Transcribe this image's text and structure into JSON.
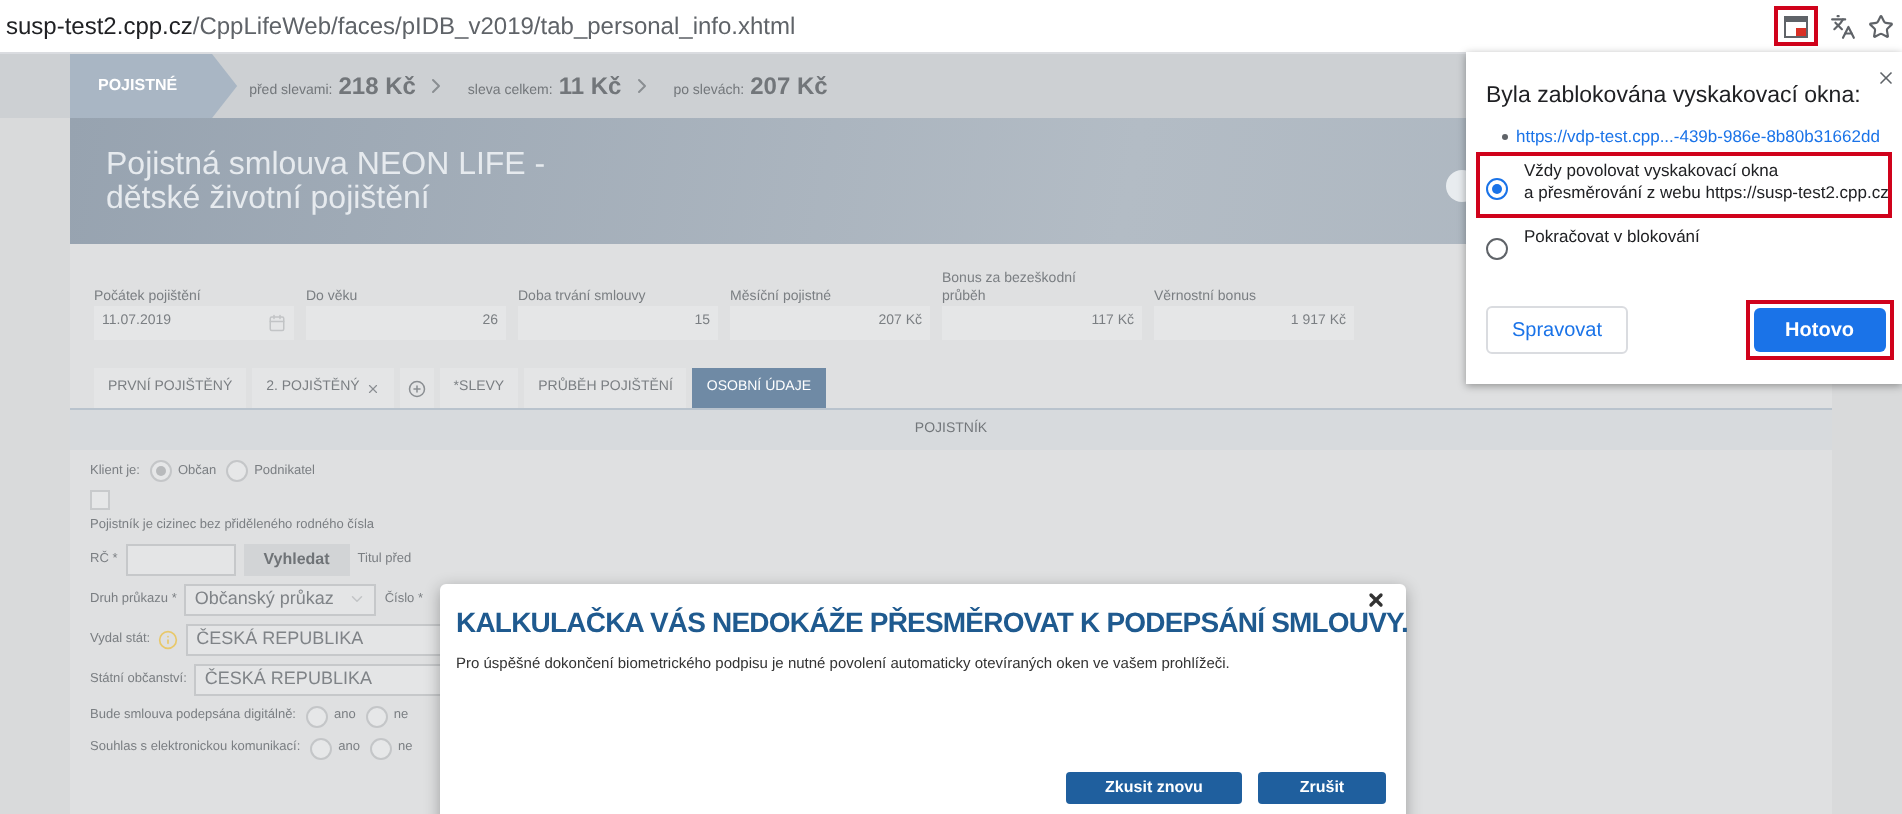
{
  "address_bar": {
    "url_host": "susp-test2.cpp.cz",
    "url_path": "/CppLifeWeb/faces/pIDB_v2019/tab_personal_info.xhtml",
    "popup_blocked_icon_highlighted": true
  },
  "premium_bar": {
    "label": "POJISTNÉ",
    "items": [
      {
        "caption": "před slevami:",
        "amount": "218 Kč"
      },
      {
        "caption": "sleva celkem:",
        "amount": "11 Kč"
      },
      {
        "caption": "po slevách:",
        "amount": "207 Kč"
      }
    ]
  },
  "banner": {
    "title": "Pojistná smlouva NEON LIFE - dětské životní pojištění"
  },
  "summary_fields": [
    {
      "label": "Počátek pojištění",
      "value": "11.07.2019",
      "kind": "date"
    },
    {
      "label": "Do věku",
      "value": "26",
      "kind": "text"
    },
    {
      "label": "Doba trvání smlouvy",
      "value": "15",
      "kind": "text"
    },
    {
      "label": "Měsíční pojistné",
      "value": "207 Kč",
      "kind": "text"
    },
    {
      "label": "Bonus za bezeškodní průběh",
      "value": "117 Kč",
      "kind": "text"
    },
    {
      "label": "Věrnostní bonus",
      "value": "1 917 Kč",
      "kind": "text"
    }
  ],
  "tabs": [
    {
      "kind": "tab",
      "label": "PRVNÍ POJIŠTĚNÝ",
      "selected": false,
      "closable": false
    },
    {
      "kind": "tab",
      "label": "2. POJIŠTĚNÝ",
      "selected": false,
      "closable": true
    },
    {
      "kind": "add",
      "selected": false
    },
    {
      "kind": "tab",
      "label": "*SLEVY",
      "selected": false,
      "closable": false
    },
    {
      "kind": "tab",
      "label": "PRŮBĚH POJIŠTĚNÍ",
      "selected": false,
      "closable": false
    },
    {
      "kind": "tab",
      "label": "OSOBNÍ ÚDAJE",
      "selected": true,
      "closable": false
    }
  ],
  "section": {
    "title": "POJISTNÍK",
    "client_type": {
      "label": "Klient je:",
      "options": [
        {
          "label": "Občan",
          "selected": true
        },
        {
          "label": "Podnikatel",
          "selected": false
        }
      ]
    },
    "foreigner_checkbox": {
      "checked": false,
      "label": "Pojistník je cizinec bez přiděleného rodného čísla"
    },
    "rc": {
      "label": "RČ *",
      "button": "Vyhledat",
      "next_label": "Titul před"
    },
    "id_type": {
      "label": "Druh průkazu *",
      "value": "Občanský průkaz",
      "next_label": "Číslo *"
    },
    "issued_by": {
      "label": "Vydal stát:",
      "value": "ČESKÁ REPUBLIKA"
    },
    "citizenship": {
      "label": "Státní občanství:",
      "value": "ČESKÁ REPUBLIKA"
    },
    "questions": [
      {
        "label": "Bude smlouva podepsána digitálně:",
        "options": [
          {
            "label": "ano",
            "selected": false
          },
          {
            "label": "ne",
            "selected": false
          }
        ]
      },
      {
        "label": "Souhlas s elektronickou komunikací:",
        "options": [
          {
            "label": "ano",
            "selected": false
          },
          {
            "label": "ne",
            "selected": false
          }
        ]
      }
    ]
  },
  "popup_blocked": {
    "title": "Byla zablokována vyskakovací okna:",
    "link": "https://vdp-test.cpp...-439b-986e-8b80b31662dd",
    "options": [
      {
        "lines": [
          "Vždy povolovat vyskakovací okna",
          "a přesměrování z webu https://susp-test2.cpp.cz"
        ],
        "selected": true,
        "highlighted": true
      },
      {
        "lines": [
          "Pokračovat v blokování"
        ],
        "selected": false,
        "highlighted": false
      }
    ],
    "manage_button": "Spravovat",
    "done_button": {
      "label": "Hotovo",
      "highlighted": true
    }
  },
  "modal": {
    "title": "KALKULAČKA VÁS NEDOKÁŽE PŘESMĚROVAT K PODEPSÁNÍ SMLOUVY.",
    "text": "Pro úspěšné dokončení biometrického podpisu je nutné povolení automaticky otevíraných oken ve vašem prohlížeči.",
    "buttons": [
      "Zkusit znovu",
      "Zrušit"
    ]
  }
}
